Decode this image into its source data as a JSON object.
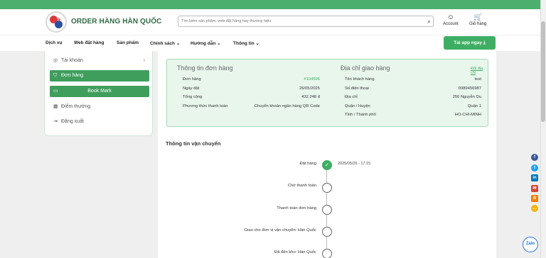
{
  "header": {
    "brand": "ORDER HÀNG HÀN QUỐC",
    "search_placeholder": "Tìm kiếm sản phẩm, web đặt hàng hay thương hiệu",
    "account_label": "Account",
    "cart_label": "Giỏ hàng"
  },
  "nav": {
    "items": [
      "Dịch vụ",
      "Web đặt hàng",
      "Sản phẩm",
      "Chính sách",
      "Hướng dẫn",
      "Thông tin"
    ],
    "app_button": "Tải app ngay"
  },
  "sidebar": {
    "account": "Tài khoản",
    "orders": "Đơn hàng",
    "bookmark": "Book Mark",
    "points": "Điểm thưởng",
    "logout": "Đăng xuất"
  },
  "order_info": {
    "title": "Thông tin đơn hàng",
    "rows": [
      {
        "label": "Đơn hàng",
        "value": "#104596"
      },
      {
        "label": "Ngày đặt",
        "value": "26/05/2025"
      },
      {
        "label": "Tổng cộng",
        "value": "432.248 đ"
      },
      {
        "label": "Phương thức thanh toán",
        "value": "Chuyển khoản ngân hàng QR Code"
      }
    ]
  },
  "address": {
    "title": "Địa chỉ giao hàng",
    "change_link": "Đổi địa chỉ",
    "rows": [
      {
        "label": "Tên khách hàng",
        "value": "test"
      },
      {
        "label": "Số điện thoại",
        "value": "0989456987"
      },
      {
        "label": "Địa chỉ",
        "value": "256 Nguyễn Du"
      },
      {
        "label": "Quận / Huyện",
        "value": "Quận 1"
      },
      {
        "label": "Tỉnh / Thành phố",
        "value": "HO-CHI-MINH"
      }
    ]
  },
  "shipping": {
    "title": "Thông tin vận chuyển",
    "steps": [
      {
        "label": "Đặt hàng",
        "time": "2025/05/26 - 17:15",
        "done": true
      },
      {
        "label": "Chờ thanh toán",
        "time": "",
        "done": false
      },
      {
        "label": "Thanh toán đơn hàng",
        "time": "",
        "done": false
      },
      {
        "label": "Giao cho đơn vị vận chuyển: Hàn Quốc",
        "time": "",
        "done": false
      },
      {
        "label": "Đã đến kho: Hàn Quốc",
        "time": "",
        "done": false
      }
    ]
  },
  "social": {
    "zalo": "Zalo"
  },
  "colors": {
    "accent": "#3fae64",
    "topbar": "#4caf6e",
    "brand": "#2f6b43"
  }
}
